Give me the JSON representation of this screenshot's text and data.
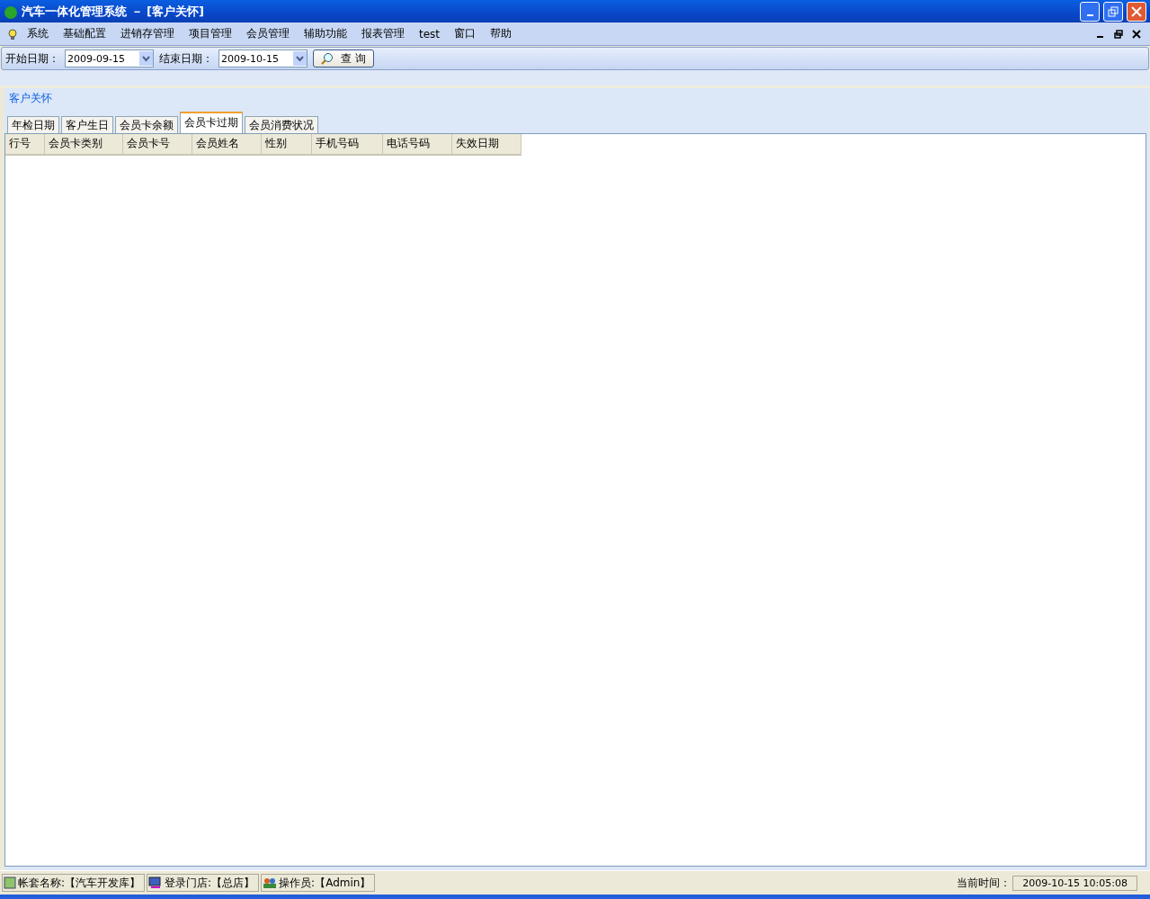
{
  "window": {
    "title": "汽车一体化管理系统 － [客户关怀]"
  },
  "menu": {
    "items": [
      "系统",
      "基础配置",
      "进销存管理",
      "项目管理",
      "会员管理",
      "辅助功能",
      "报表管理",
      "test",
      "窗口",
      "帮助"
    ]
  },
  "toolbar": {
    "start_label": "开始日期：",
    "start_value": "2009-09-15",
    "end_label": "结束日期：",
    "end_value": "2009-10-15",
    "query_button": "查 询"
  },
  "group": {
    "title": "客户关怀"
  },
  "tabs": [
    {
      "label": "年检日期",
      "selected": false
    },
    {
      "label": "客户生日",
      "selected": false
    },
    {
      "label": "会员卡余额",
      "selected": false
    },
    {
      "label": "会员卡过期",
      "selected": true
    },
    {
      "label": "会员消费状况",
      "selected": false
    }
  ],
  "table": {
    "columns": [
      "行号",
      "会员卡类别",
      "会员卡号",
      "会员姓名",
      "性别",
      "手机号码",
      "电话号码",
      "失效日期"
    ]
  },
  "status_bar": {
    "items": [
      {
        "kind": "account",
        "text": "帐套名称:【汽车开发库】"
      },
      {
        "kind": "store",
        "text": "登录门店:【总店】"
      },
      {
        "kind": "operator",
        "text": "操作员:【Admin】"
      }
    ],
    "time_label": "当前时间：",
    "time_value": "2009-10-15 10:05:08"
  }
}
